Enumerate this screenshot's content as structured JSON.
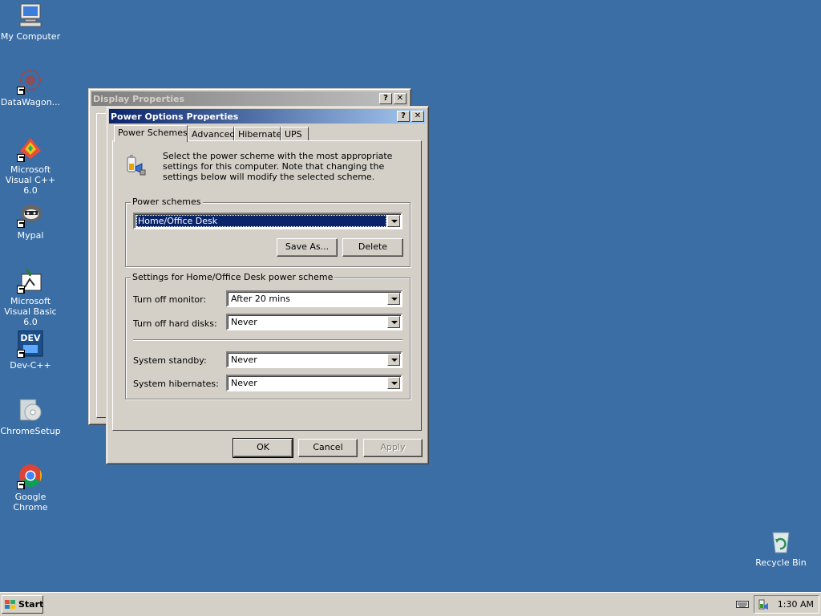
{
  "desktop": {
    "icons": [
      {
        "label": "My Computer"
      },
      {
        "label": "DataWagon..."
      },
      {
        "label": "Microsoft Visual C++ 6.0"
      },
      {
        "label": "Mypal"
      },
      {
        "label": "Microsoft Visual Basic 6.0"
      },
      {
        "label": "Dev-C++"
      },
      {
        "label": "ChromeSetup"
      },
      {
        "label": "Google Chrome"
      },
      {
        "label": "Recycle Bin"
      }
    ],
    "background_color": "#3a6ea5"
  },
  "display_window": {
    "title": "Display Properties",
    "help_btn": "?",
    "close_btn": "✕"
  },
  "power_window": {
    "title": "Power Options Properties",
    "help_btn": "?",
    "close_btn": "✕",
    "tabs": [
      {
        "label": "Power Schemes",
        "selected": true
      },
      {
        "label": "Advanced",
        "selected": false
      },
      {
        "label": "Hibernate",
        "selected": false
      },
      {
        "label": "UPS",
        "selected": false
      }
    ],
    "description": "Select the power scheme with the most appropriate settings for this computer. Note that changing the settings below will modify the selected scheme.",
    "schemes_group": {
      "label": "Power schemes",
      "selected": "Home/Office Desk",
      "save_as": "Save As...",
      "delete": "Delete"
    },
    "settings_group": {
      "label": "Settings for Home/Office Desk power scheme",
      "rows": [
        {
          "label": "Turn off monitor:",
          "value": "After 20 mins"
        },
        {
          "label": "Turn off hard disks:",
          "value": "Never"
        },
        {
          "label": "System standby:",
          "value": "Never"
        },
        {
          "label": "System hibernates:",
          "value": "Never"
        }
      ]
    },
    "buttons": {
      "ok": "OK",
      "cancel": "Cancel",
      "apply": "Apply"
    }
  },
  "taskbar": {
    "start_label": "Start",
    "clock": "1:30 AM"
  }
}
